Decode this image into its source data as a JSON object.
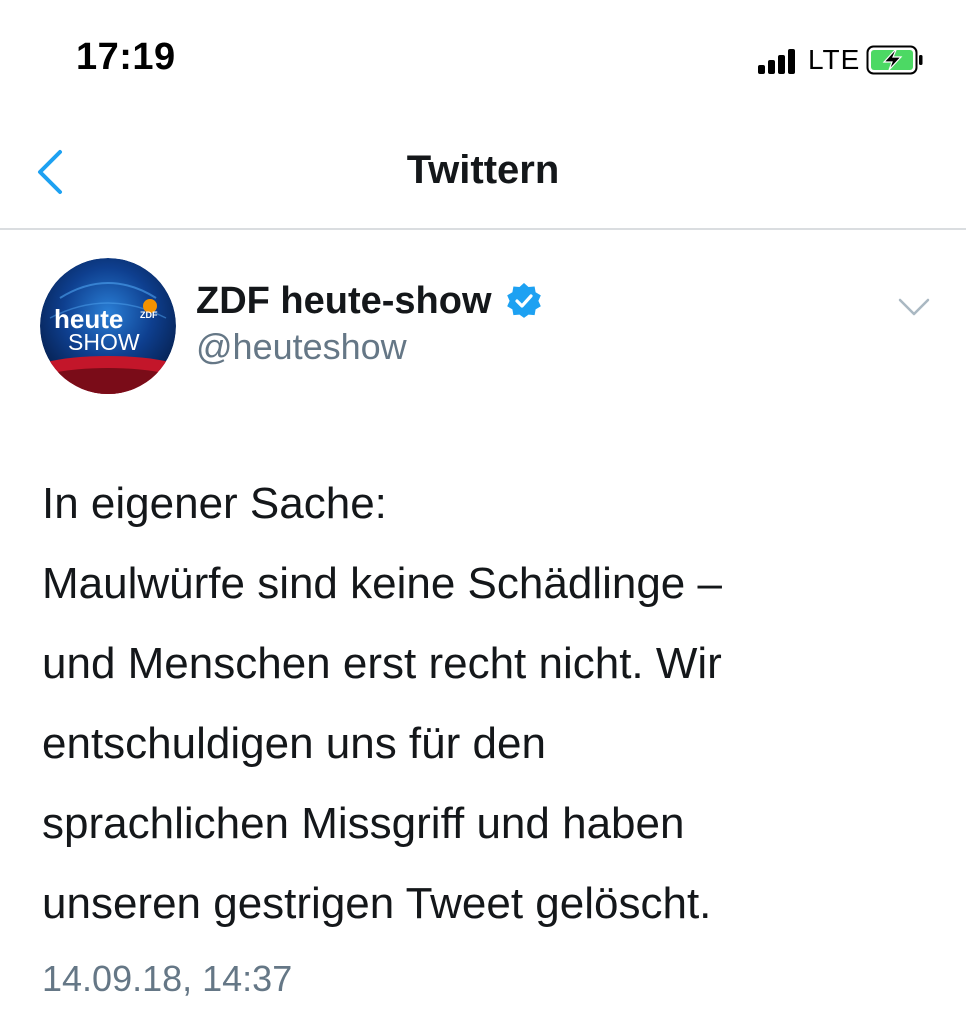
{
  "status_bar": {
    "time": "17:19",
    "network": "LTE",
    "battery_state": "charging",
    "battery_color": "#4cd964"
  },
  "nav": {
    "back_icon": "chevron-left-icon",
    "title": "Twittern",
    "accent_color": "#1da1f2"
  },
  "tweet": {
    "avatar": {
      "line1": "heute",
      "line2": "SHOW",
      "badge": "ZDF"
    },
    "display_name": "ZDF heute-show",
    "verified": true,
    "handle": "@heuteshow",
    "menu_icon": "chevron-down-icon",
    "text_lines": [
      "In eigener Sache:",
      "Maulwürfe sind keine Schädlinge –",
      "und Menschen erst recht nicht. Wir",
      "entschuldigen uns für den",
      "sprachlichen Missgriff und haben",
      "unseren gestrigen Tweet gelöscht."
    ],
    "timestamp": "14.09.18, 14:37"
  }
}
